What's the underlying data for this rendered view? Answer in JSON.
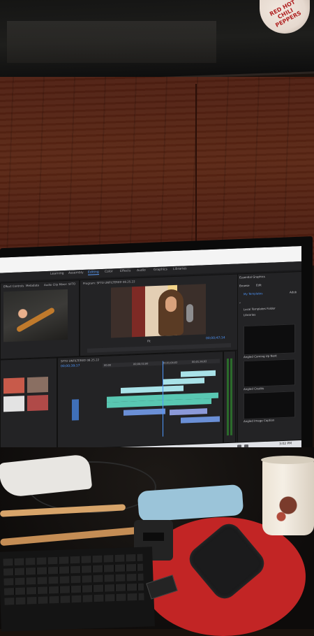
{
  "poster": {
    "logo_text": "RED HOT CHILI PEPPERS"
  },
  "app": {
    "workspaces": [
      "Learning",
      "Assembly",
      "Editing",
      "Color",
      "Effects",
      "Audio",
      "Graphics",
      "Libraries"
    ],
    "active_workspace": "Editing"
  },
  "source_panel": {
    "tabs": [
      "Effect Controls",
      "Metadata",
      "Audio Clip Mixer: SFTO"
    ]
  },
  "program_panel": {
    "title": "Program: SFTO UNFILTERED 08.25.22",
    "timecode": "00;00;47;14",
    "fit": "Fit"
  },
  "timeline": {
    "sequence_name": "SFTO UNFILTERED 08.25.22",
    "timecode": "00;00;39;17",
    "ruler_labels": [
      "00;00",
      "00;00;32;00",
      "00;01;04;02",
      "00;01;36;02"
    ]
  },
  "essential_graphics": {
    "title": "Essential Graphics",
    "tabs": [
      "Browse",
      "Edit"
    ],
    "dropdown": "My Templates",
    "adobe_label": "Adob",
    "checkbox_local": "Local Templates Folder",
    "checkbox_libraries": "Libraries",
    "templates": [
      "Angled Coming Up Next",
      "Angled Credits",
      "Angled Image Caption"
    ]
  },
  "taskbar": {
    "time": "3:02 PM"
  },
  "colors": {
    "accent": "#4e98ff",
    "clip_green": "#59c7b2",
    "mousepad": "#c22525"
  }
}
